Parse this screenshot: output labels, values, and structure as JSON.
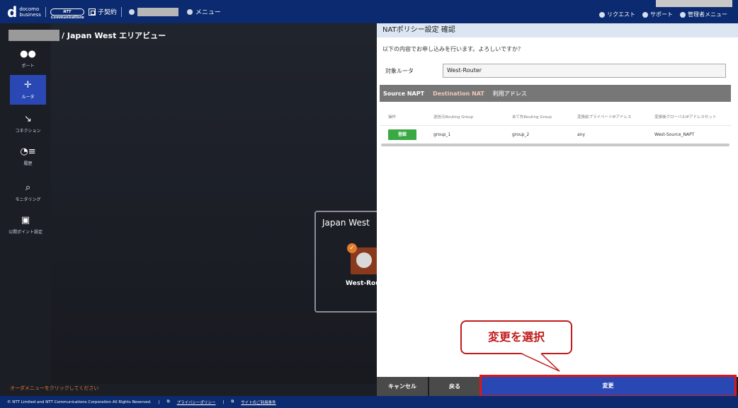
{
  "topbar": {
    "brand_line1": "docomo",
    "brand_line2": "business",
    "ntt_logo": "NTT Communications",
    "contract_label": "子契約",
    "menu_label": "メニュー",
    "request_label": "リクエスト",
    "support_label": "サポート",
    "admin_menu_label": "管理者メニュー"
  },
  "sidebar": {
    "items": [
      {
        "label": "ポート",
        "icon": "port-icon",
        "glyph": "●●"
      },
      {
        "label": "ルータ",
        "icon": "router-icon",
        "glyph": "✛"
      },
      {
        "label": "コネクション",
        "icon": "connection-icon",
        "glyph": "↘"
      },
      {
        "label": "履歴",
        "icon": "history-icon",
        "glyph": "◔≡"
      },
      {
        "label": "モニタリング",
        "icon": "monitoring-icon",
        "glyph": "⌕"
      },
      {
        "label": "公開ポイント設定",
        "icon": "monitor-icon",
        "glyph": "▣"
      }
    ],
    "active_index": 1
  },
  "canvas": {
    "breadcrumb": "/ Japan West エリアビュー",
    "region_title": "Japan West",
    "router_label": "West-Rout",
    "order_hint": "オーダメニューをクリックしてください"
  },
  "panel": {
    "title": "NATポリシー設定 確認",
    "message": "以下の内容でお申し込みを行います。よろしいですか？",
    "target_label": "対象ルータ",
    "target_value": "West-Router",
    "tabs": [
      "Source NAPT",
      "Destination NAT",
      "利用アドレス"
    ],
    "table": {
      "headers": [
        "操作",
        "送信元Routing Group",
        "あて先Routing Group",
        "変換前プライベートIPアドレス",
        "変換後グローバルIPアドレスセット"
      ],
      "row": {
        "action": "登録",
        "src": "group_1",
        "dst": "group_2",
        "private_ip": "any",
        "global_set": "West-Source_NAPT"
      }
    }
  },
  "buttons": {
    "cancel": "キャンセル",
    "back": "戻る",
    "change": "変更"
  },
  "callout": {
    "text": "変更を選択"
  },
  "footer": {
    "copyright": "© NTT Limited and NTT Communications Corporation All Rights Reserved.",
    "privacy": "プライバシーポリシー",
    "terms": "サイトのご利用条件"
  },
  "colors": {
    "navy": "#0b2a6f",
    "accent_blue": "#2948b4",
    "register_green": "#3aa943",
    "highlight_red": "#e31414"
  }
}
